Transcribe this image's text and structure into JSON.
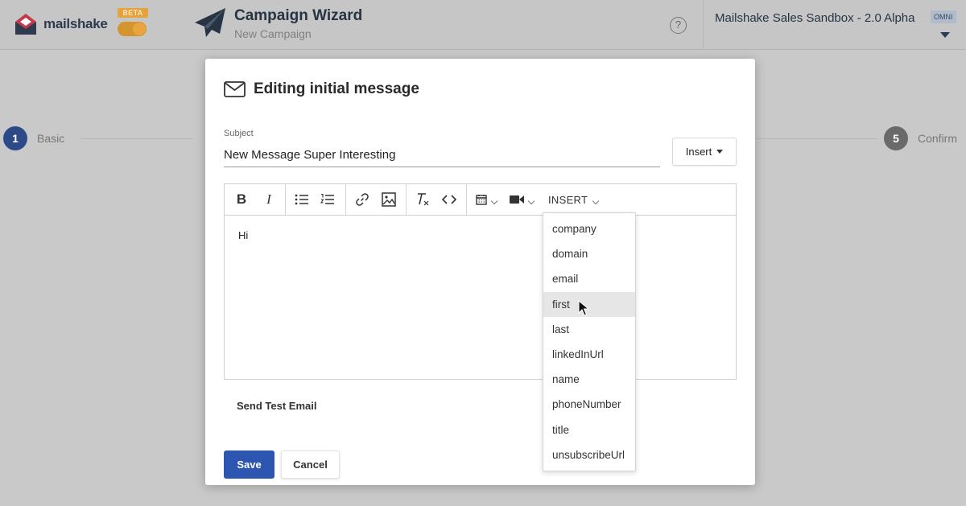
{
  "app": {
    "logo_text": "mailshake",
    "beta_label": "BETA",
    "wizard_title": "Campaign Wizard",
    "wizard_subtitle": "New Campaign",
    "help_symbol": "?",
    "account_name": "Mailshake Sales Sandbox - 2.0 Alpha",
    "account_badge": "OMNI"
  },
  "steps": [
    {
      "number": "1",
      "label": "Basic"
    },
    {
      "number": "5",
      "label": "Confirm"
    }
  ],
  "modal": {
    "title": "Editing initial message",
    "subject_label": "Subject",
    "subject_value": "New Message Super Interesting",
    "insert_button": "Insert",
    "toolbar_insert_label": "INSERT",
    "body_text": "Hi",
    "send_test_label": "Send Test Email",
    "save_label": "Save",
    "cancel_label": "Cancel"
  },
  "insert_menu": {
    "items": [
      "company",
      "domain",
      "email",
      "first",
      "last",
      "linkedInUrl",
      "name",
      "phoneNumber",
      "title",
      "unsubscribeUrl"
    ],
    "highlighted": "first"
  },
  "colors": {
    "primary_button": "#2c56b0",
    "beta_orange": "#e6a33c",
    "step_active": "#2c4a88",
    "overlay": "#c9c9c9"
  },
  "icons": [
    "mailshake-logo-icon",
    "paper-plane-icon",
    "help-icon",
    "caret-down-icon",
    "envelope-icon",
    "bold-icon",
    "italic-icon",
    "bullet-list-icon",
    "numbered-list-icon",
    "link-icon",
    "image-icon",
    "clear-format-icon",
    "code-icon",
    "calendar-icon",
    "video-icon",
    "cursor-icon"
  ]
}
